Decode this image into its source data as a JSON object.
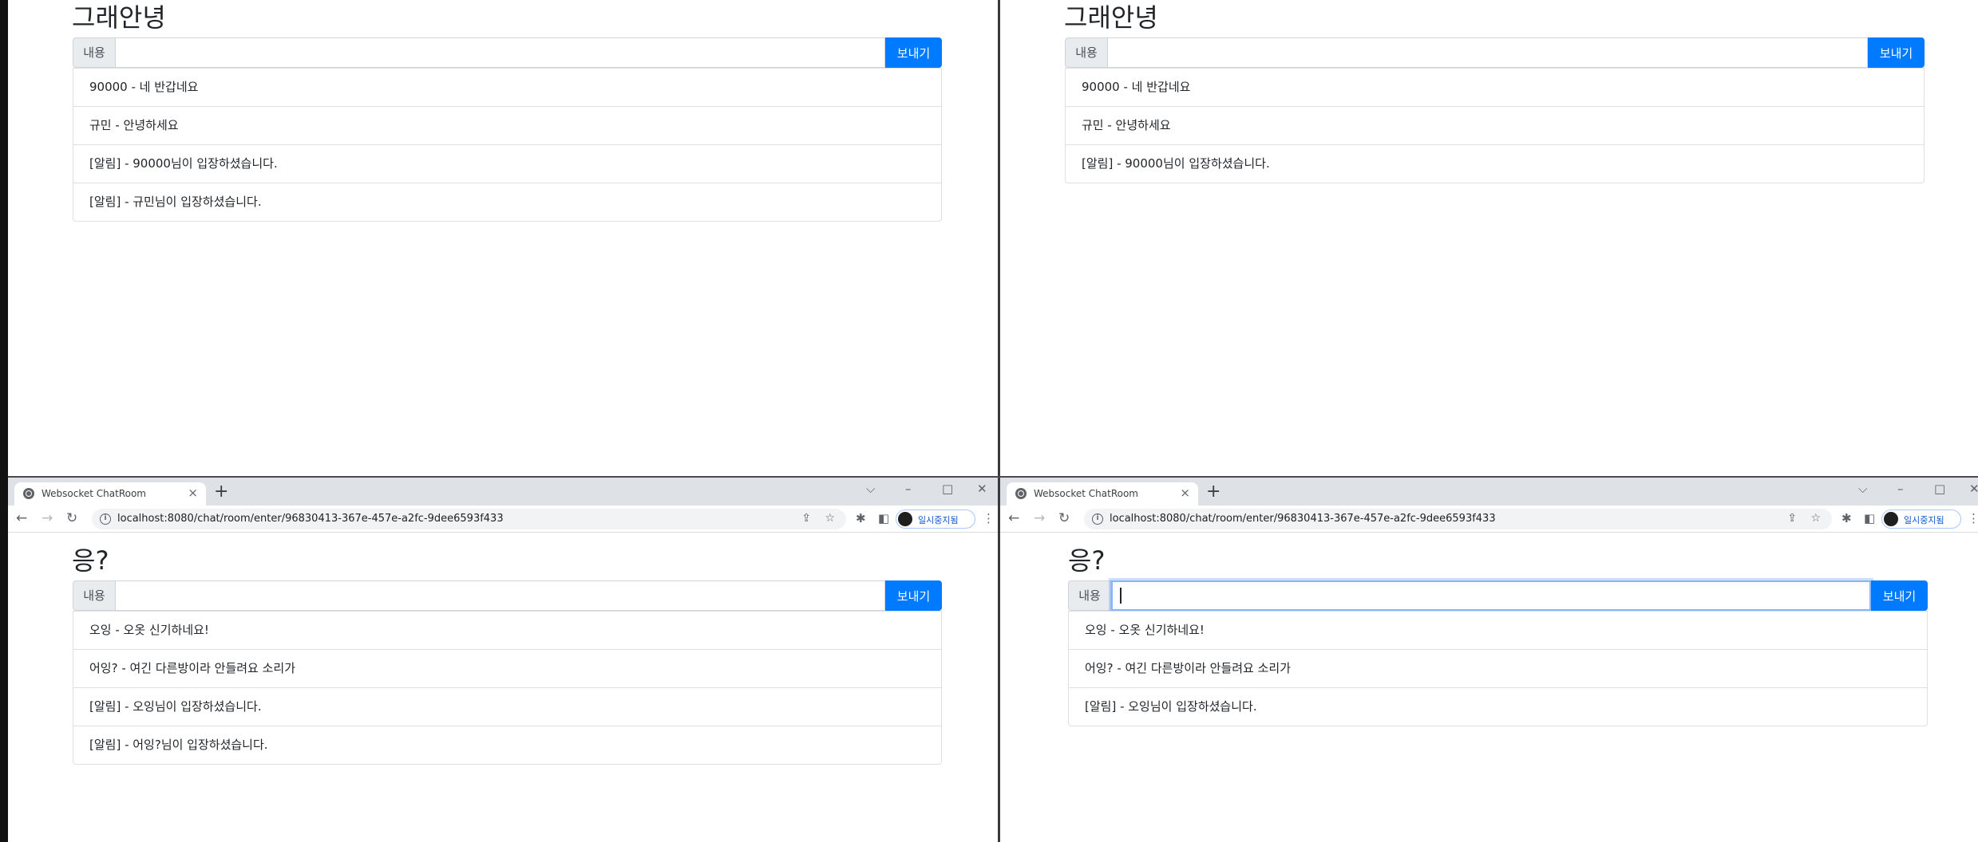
{
  "tab_title": "Websocket ChatRoom",
  "url": "localhost:8080/chat/room/enter/96830413-367e-457e-a2fc-9dee6593f433",
  "profile_label": "일시중지됨",
  "input_label": "내용",
  "send_label": "보내기",
  "new_tab_symbol": "+",
  "tab_close_symbol": "×",
  "window_controls": {
    "dropdown": "⌵",
    "minimize": "–",
    "maximize": "□",
    "close": "✕"
  },
  "windows": {
    "top_left": {
      "room_name": "그래안녕",
      "messages": [
        "90000 - 네 반갑네요",
        "규민 - 안녕하세요",
        "[알림] - 90000님이 입장하셨습니다.",
        "[알림] - 규민님이 입장하셨습니다."
      ]
    },
    "top_right": {
      "room_name": "그래안녕",
      "messages": [
        "90000 - 네 반갑네요",
        "규민 - 안녕하세요",
        "[알림] - 90000님이 입장하셨습니다."
      ]
    },
    "bottom_left": {
      "room_name": "응?",
      "messages": [
        "오잉 - 오옷 신기하네요!",
        "어잉? - 여긴 다른방이라 안들려요 소리가",
        "[알림] - 오잉님이 입장하셨습니다.",
        "[알림] - 어잉?님이 입장하셨습니다."
      ]
    },
    "bottom_right": {
      "room_name": "응?",
      "messages": [
        "오잉 - 오옷 신기하네요!",
        "어잉? - 여긴 다른방이라 안들려요 소리가",
        "[알림] - 오잉님이 입장하셨습니다."
      ]
    }
  },
  "colors": {
    "primary": "#007bff",
    "tabstrip": "#dee1e6",
    "omnibox": "#f1f3f4",
    "border": "#dfdfdf",
    "input_addon": "#e9ecef",
    "focus_ring": "#86b7fe"
  }
}
